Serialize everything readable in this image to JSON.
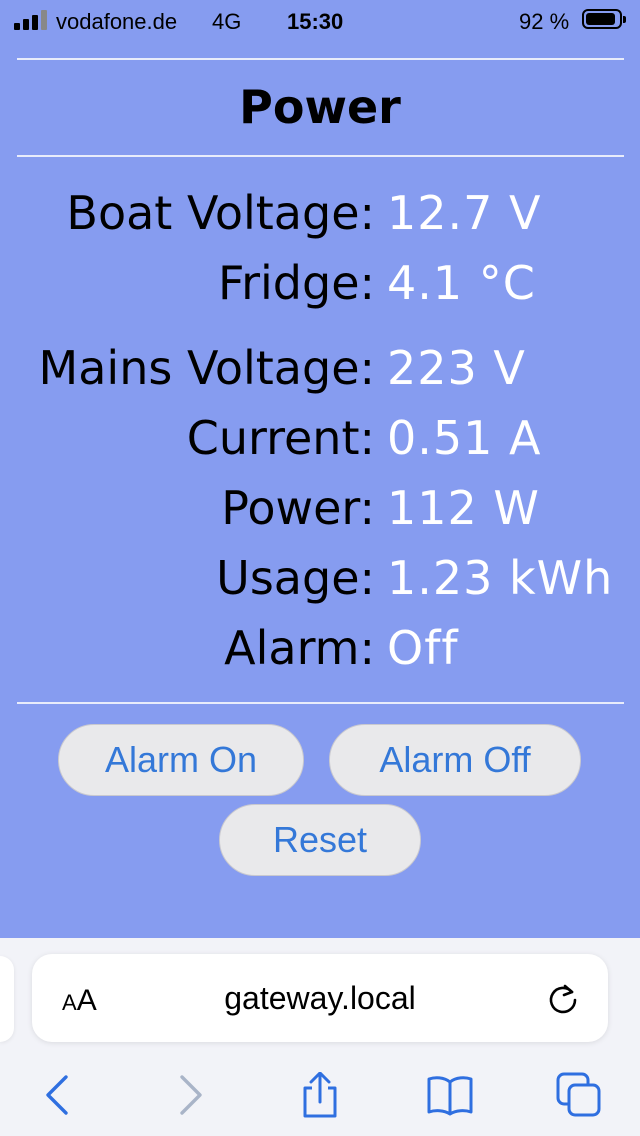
{
  "status_bar": {
    "carrier": "vodafone.de",
    "network": "4G",
    "time": "15:30",
    "battery_percent": "92 %",
    "battery_level": 0.92
  },
  "page": {
    "title": "Power",
    "readings": [
      {
        "label": "Boat Voltage:",
        "value": "12.7 V"
      },
      {
        "label": "Fridge:",
        "value": "4.1 °C"
      },
      {
        "label": "Mains Voltage:",
        "value": "223 V"
      },
      {
        "label": "Current:",
        "value": "0.51 A"
      },
      {
        "label": "Power:",
        "value": "112 W"
      },
      {
        "label": "Usage:",
        "value": "1.23 kWh"
      },
      {
        "label": "Alarm:",
        "value": "Off"
      }
    ],
    "buttons": {
      "alarm_on": "Alarm On",
      "alarm_off": "Alarm Off",
      "reset": "Reset"
    }
  },
  "browser": {
    "text_size_small": "A",
    "text_size_large": "A",
    "url": "gateway.local",
    "icons": [
      "text-size-icon",
      "reload-icon",
      "back-icon",
      "forward-icon",
      "share-icon",
      "bookmarks-icon",
      "tabs-icon"
    ]
  },
  "colors": {
    "page_background": "#869cf0",
    "value_text": "#ffffff",
    "button_text": "#3478d8",
    "toolbar_active": "#2f6fe0",
    "toolbar_disabled": "#a9b4c8"
  }
}
